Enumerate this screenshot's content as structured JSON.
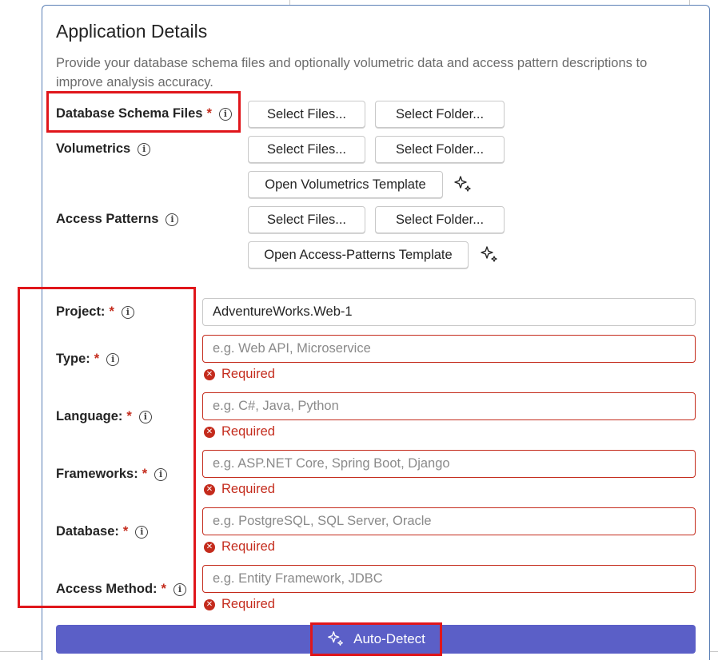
{
  "panel": {
    "title": "Application Details",
    "description": "Provide your database schema files and optionally volumetric data and access pattern descriptions to improve analysis accuracy."
  },
  "files": {
    "schema_label": "Database Schema Files",
    "volumetrics_label": "Volumetrics",
    "access_patterns_label": "Access Patterns",
    "select_files": "Select Files...",
    "select_folder": "Select Folder...",
    "volumetrics_template": "Open Volumetrics Template",
    "access_patterns_template": "Open Access-Patterns Template"
  },
  "required_mark": "*",
  "info_glyph": "i",
  "error_glyph": "✕",
  "fields": {
    "project": {
      "label": "Project:",
      "value": "AdventureWorks.Web-1"
    },
    "type": {
      "label": "Type:",
      "placeholder": "e.g. Web API, Microservice",
      "error": "Required"
    },
    "language": {
      "label": "Language:",
      "placeholder": "e.g. C#, Java, Python",
      "error": "Required"
    },
    "frameworks": {
      "label": "Frameworks:",
      "placeholder": "e.g. ASP.NET Core, Spring Boot, Django",
      "error": "Required"
    },
    "database": {
      "label": "Database:",
      "placeholder": "e.g. PostgreSQL, SQL Server, Oracle",
      "error": "Required"
    },
    "access_method": {
      "label": "Access Method:",
      "placeholder": "e.g. Entity Framework, JDBC",
      "error": "Required"
    }
  },
  "auto_detect": {
    "label": "Auto-Detect"
  },
  "colors": {
    "accent": "#5b5fc7",
    "error": "#c42b1c",
    "highlight": "#e0161b"
  }
}
